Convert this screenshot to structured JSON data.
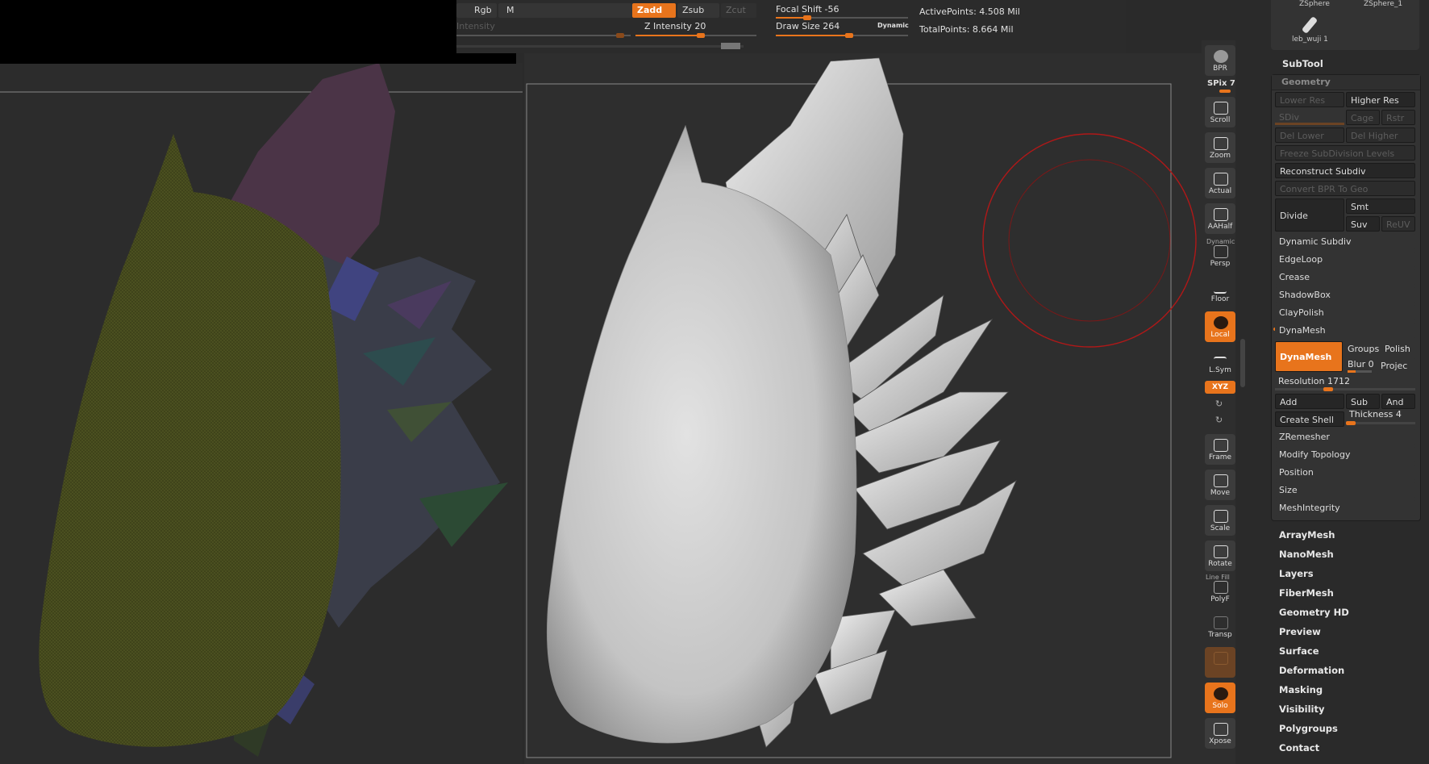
{
  "topbar": {
    "rgb": "Rgb",
    "m": "M",
    "zadd": "Zadd",
    "zsub": "Zsub",
    "zcut": "Zcut",
    "intensity": "Intensity",
    "z_intensity": "Z Intensity 20",
    "focal_shift": "Focal Shift -56",
    "draw_size": "Draw Size 264",
    "dynamic": "Dynamic",
    "active_points": "ActivePoints: 4.508 Mil",
    "total_points": "TotalPoints: 8.664 Mil"
  },
  "tools": {
    "bpr": "BPR",
    "spix": "SPix 7",
    "scroll": "Scroll",
    "zoom": "Zoom",
    "actual": "Actual",
    "aahalf": "AAHalf",
    "dynamic": "Dynamic",
    "persp": "Persp",
    "floor": "Floor",
    "local": "Local",
    "lsym": "L.Sym",
    "xyz": "XYZ",
    "frame": "Frame",
    "move": "Move",
    "scale": "Scale",
    "rotate": "Rotate",
    "line_fill": "Line Fill",
    "polyf": "PolyF",
    "transp": "Transp",
    "solo": "Solo",
    "xpose": "Xpose"
  },
  "panel": {
    "zsphere": "ZSphere",
    "zsphere1": "ZSphere_1",
    "thumb_label": "leb_wuji 1",
    "subtool": "SubTool",
    "geometry": "Geometry",
    "lower_res": "Lower Res",
    "higher_res": "Higher Res",
    "sdiv": "SDiv",
    "cage": "Cage",
    "rstr": "Rstr",
    "del_lower": "Del Lower",
    "del_higher": "Del Higher",
    "freeze": "Freeze SubDivision Levels",
    "reconstruct": "Reconstruct Subdiv",
    "convert_bpr": "Convert BPR To Geo",
    "divide": "Divide",
    "smt": "Smt",
    "suv": "Suv",
    "reuv": "ReUV",
    "dynamic_subdiv": "Dynamic Subdiv",
    "edgeloop": "EdgeLoop",
    "crease": "Crease",
    "shadowbox": "ShadowBox",
    "claypolish": "ClayPolish",
    "dynamesh_head": "DynaMesh",
    "dynamesh_btn": "DynaMesh",
    "groups": "Groups",
    "polish": "Polish",
    "blur": "Blur 0",
    "project": "Projec",
    "resolution": "Resolution 1712",
    "add": "Add",
    "sub": "Sub",
    "and": "And",
    "create_shell": "Create Shell",
    "thickness": "Thickness 4",
    "zremesher": "ZRemesher",
    "modify_topology": "Modify Topology",
    "position": "Position",
    "size": "Size",
    "meshintegrity": "MeshIntegrity",
    "menu": [
      "ArrayMesh",
      "NanoMesh",
      "Layers",
      "FiberMesh",
      "Geometry HD",
      "Preview",
      "Surface",
      "Deformation",
      "Masking",
      "Visibility",
      "Polygroups",
      "Contact"
    ]
  },
  "colors": {
    "accent": "#e8741c",
    "brush_circle": "#b01818"
  },
  "sliders": {
    "focal_shift": -56,
    "draw_size": 264,
    "z_intensity": 20,
    "resolution": 1712,
    "thickness": 4,
    "spix": 7
  }
}
